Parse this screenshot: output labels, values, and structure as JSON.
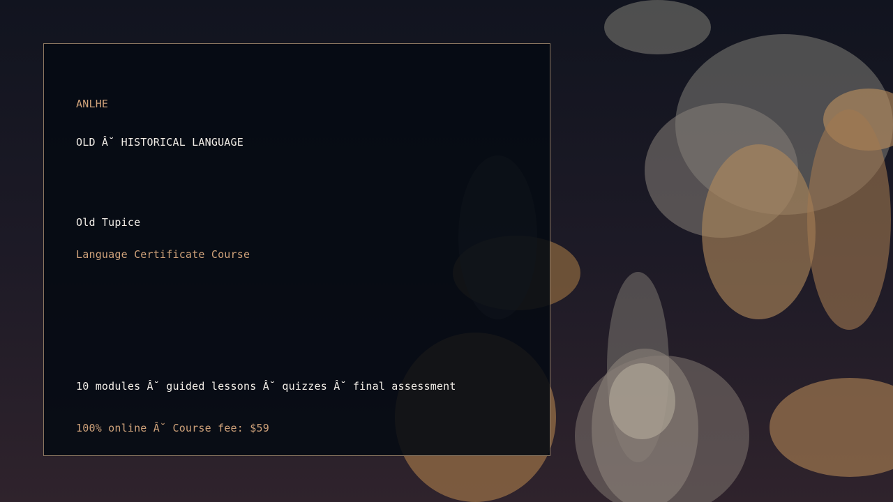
{
  "card": {
    "brand": "ANLHE",
    "category": "OLD Â˘ HISTORICAL LANGUAGE",
    "course_name": "Old Tupice",
    "course_type": "Language Certificate Course",
    "features": "10 modules Â˘ guided lessons Â˘ quizzes Â˘ final assessment",
    "pricing": "100% online Â˘ Course fee: $59"
  },
  "colors": {
    "accent": "#cfa27a",
    "text": "#f1ede7",
    "card_border": "#8a7660",
    "card_background": "#050a12"
  }
}
